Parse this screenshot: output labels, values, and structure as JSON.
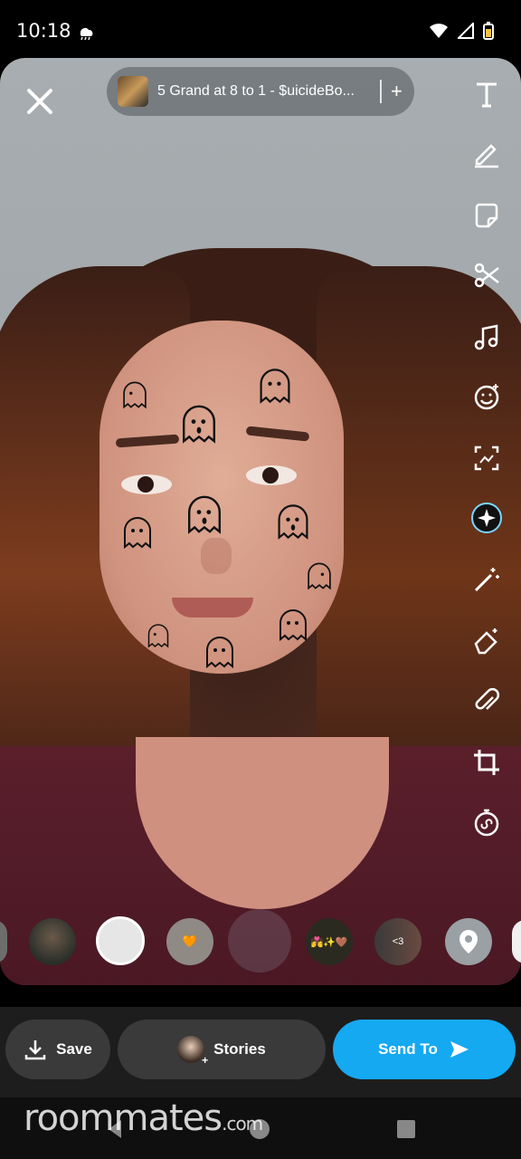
{
  "status_bar": {
    "time": "10:18"
  },
  "music": {
    "title": "5 Grand at 8 to 1 - $uicideBo...",
    "add": "+"
  },
  "tools": [
    "text-icon",
    "pencil-icon",
    "sticker-icon",
    "scissors-icon",
    "music-icon",
    "emoji-icon",
    "scan-icon",
    "ai-sparkle-icon",
    "magic-wand-icon",
    "eraser-icon",
    "paperclip-icon",
    "crop-icon",
    "timer-icon"
  ],
  "carousel": {
    "chips": [
      "",
      "🧡",
      "",
      "💏✨🤎",
      "<3"
    ]
  },
  "actions": {
    "save": "Save",
    "stories": "Stories",
    "send_to": "Send To"
  },
  "watermark": {
    "brand": "roommates",
    "suffix": ".com"
  },
  "colors": {
    "send_button": "#15a9f2",
    "bottom_bar": "#1d1d1d",
    "pill": "#3a3a3a"
  }
}
